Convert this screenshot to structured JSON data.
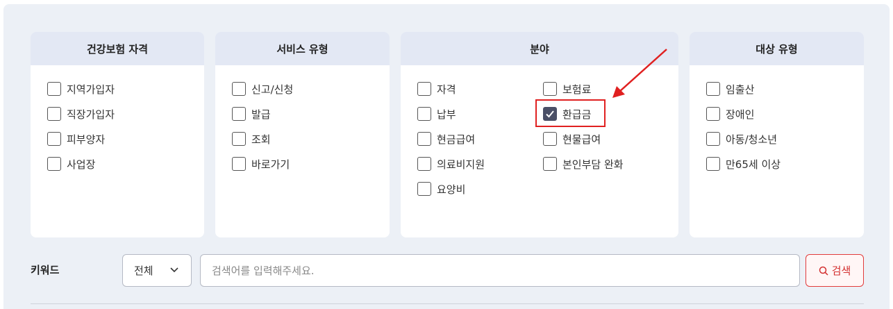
{
  "panels": {
    "eligibility": {
      "title": "건강보험 자격",
      "options": [
        {
          "label": "지역가입자",
          "checked": false
        },
        {
          "label": "직장가입자",
          "checked": false
        },
        {
          "label": "피부양자",
          "checked": false
        },
        {
          "label": "사업장",
          "checked": false
        }
      ]
    },
    "service_type": {
      "title": "서비스 유형",
      "options": [
        {
          "label": "신고/신청",
          "checked": false
        },
        {
          "label": "발급",
          "checked": false
        },
        {
          "label": "조회",
          "checked": false
        },
        {
          "label": "바로가기",
          "checked": false
        }
      ]
    },
    "field": {
      "title": "분야",
      "options": [
        {
          "label": "자격",
          "checked": false
        },
        {
          "label": "보험료",
          "checked": false
        },
        {
          "label": "납부",
          "checked": false
        },
        {
          "label": "환급금",
          "checked": true
        },
        {
          "label": "현금급여",
          "checked": false
        },
        {
          "label": "현물급여",
          "checked": false
        },
        {
          "label": "의료비지원",
          "checked": false
        },
        {
          "label": "본인부담 완화",
          "checked": false
        },
        {
          "label": "요양비",
          "checked": false
        }
      ]
    },
    "target_type": {
      "title": "대상 유형",
      "options": [
        {
          "label": "임출산",
          "checked": false
        },
        {
          "label": "장애인",
          "checked": false
        },
        {
          "label": "아동/청소년",
          "checked": false
        },
        {
          "label": "만65세 이상",
          "checked": false
        }
      ]
    }
  },
  "keyword": {
    "label": "키워드",
    "scope_selected": "전체",
    "placeholder": "검색어를 입력해주세요.",
    "value": "",
    "search_label": "검색"
  },
  "colors": {
    "background": "#ecf0f6",
    "panel_header": "#e3e8f4",
    "checked_box": "#4a4f66",
    "annotation_red": "#e02020",
    "search_red": "#d32f2f"
  }
}
